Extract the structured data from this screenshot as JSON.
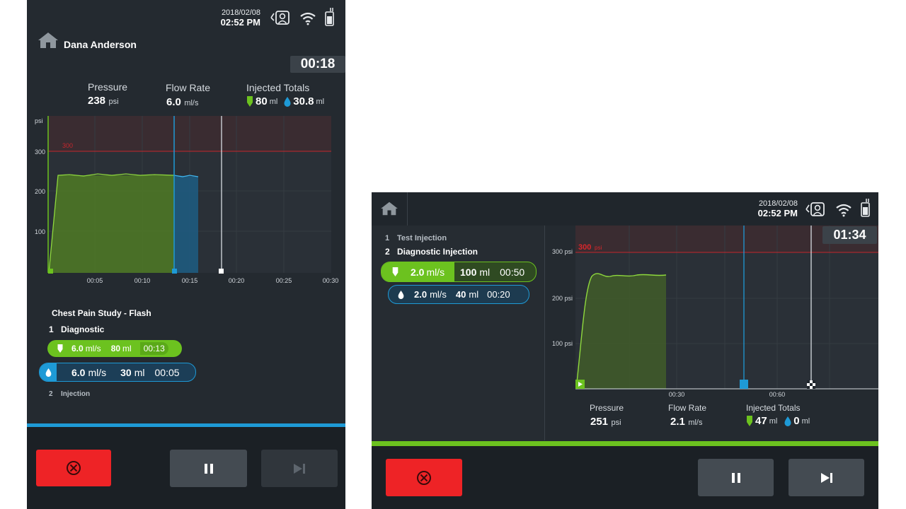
{
  "left": {
    "status": {
      "date": "2018/02/08",
      "time": "02:52 PM"
    },
    "patient_name": "Dana Anderson",
    "timer": "00:18",
    "readouts": {
      "pressure_label": "Pressure",
      "pressure_value": "238",
      "pressure_unit": "psi",
      "flow_label": "Flow Rate",
      "flow_value": "6.0",
      "flow_unit": "ml/s",
      "totals_label": "Injected Totals",
      "contrast_value": "80",
      "contrast_unit": "ml",
      "saline_value": "30.8",
      "saline_unit": "ml"
    },
    "chart": {
      "y_unit": "psi",
      "y_ticks": [
        "300",
        "200",
        "100"
      ],
      "x_ticks": [
        "00:05",
        "00:10",
        "00:15",
        "00:20",
        "00:25",
        "00:30"
      ],
      "limit_label": "300"
    },
    "protocol": {
      "title": "Chest Pain Study - Flash",
      "phase1_num": "1",
      "phase1_name": "Diagnostic",
      "step1": {
        "flow": "6.0",
        "flow_unit": "ml/s",
        "volume": "80",
        "vol_unit": "ml",
        "duration": "00:13"
      },
      "step2": {
        "flow": "6.0",
        "flow_unit": "ml/s",
        "volume": "30",
        "vol_unit": "ml",
        "duration": "00:05"
      },
      "phase2_num": "2",
      "phase2_name": "Injection"
    },
    "progress_color": "#1e9ad6"
  },
  "right": {
    "status": {
      "date": "2018/02/08",
      "time": "02:52 PM"
    },
    "timer": "01:34",
    "phases": [
      {
        "num": "1",
        "name": "Test Injection"
      },
      {
        "num": "2",
        "name": "Diagnostic Injection"
      }
    ],
    "step1": {
      "flow": "2.0",
      "flow_unit": "ml/s",
      "volume": "100",
      "vol_unit": "ml",
      "duration": "00:50"
    },
    "step2": {
      "flow": "2.0",
      "flow_unit": "ml/s",
      "volume": "40",
      "vol_unit": "ml",
      "duration": "00:20"
    },
    "chart": {
      "y_ticks": [
        "300 psi",
        "200 psi",
        "100 psi"
      ],
      "x_ticks": [
        "00:30",
        "00:60"
      ],
      "limit_value": "300",
      "limit_unit": "psi"
    },
    "readouts": {
      "pressure_label": "Pressure",
      "pressure_value": "251",
      "pressure_unit": "psi",
      "flow_label": "Flow Rate",
      "flow_value": "2.1",
      "flow_unit": "ml/s",
      "totals_label": "Injected Totals",
      "contrast_value": "47",
      "contrast_unit": "ml",
      "saline_value": "0",
      "saline_unit": "ml"
    },
    "progress_color": "#6cc21f"
  },
  "colors": {
    "contrast": "#6cc21f",
    "saline": "#1e9ad6",
    "stop": "#ee2326",
    "limit": "#d9262b"
  },
  "icons": [
    "home-icon",
    "patient-monitor-icon",
    "wifi-icon",
    "battery-icon",
    "stop-icon",
    "pause-icon",
    "skip-next-icon",
    "syringe-icon",
    "drop-icon",
    "checkered-flag-icon"
  ]
}
